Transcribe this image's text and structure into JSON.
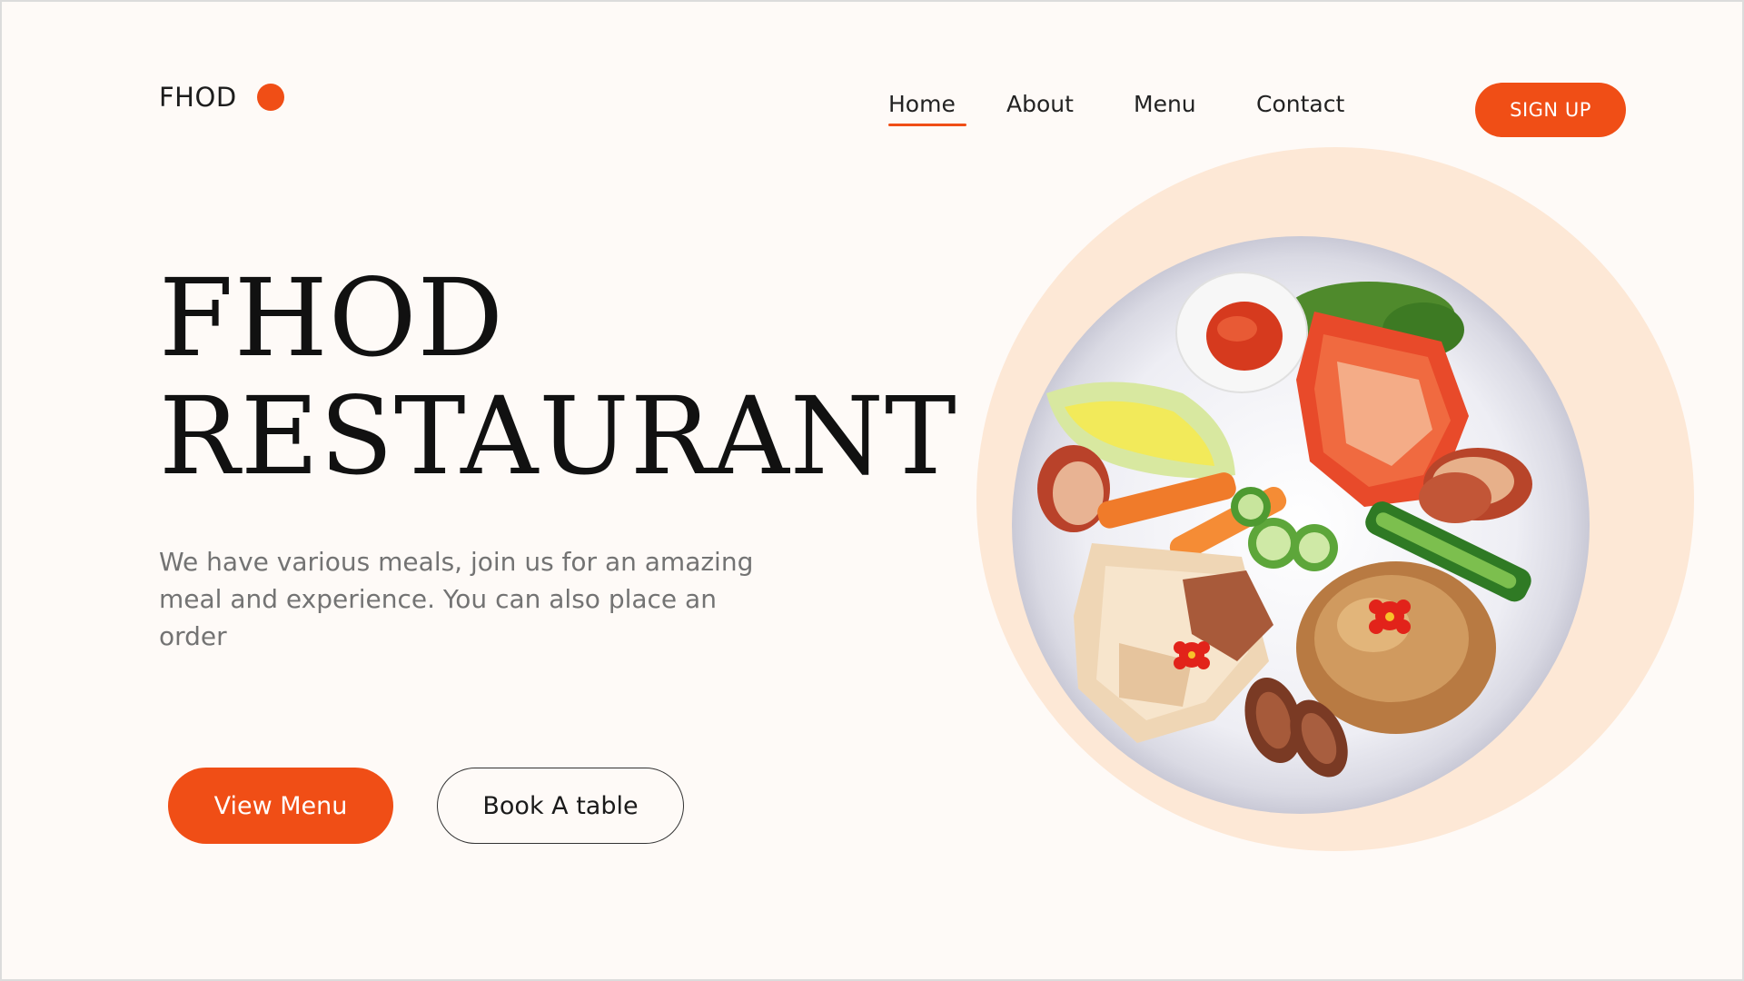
{
  "brand": {
    "name": "FHOD",
    "accent_color": "#f04e16"
  },
  "nav": {
    "items": [
      {
        "label": "Home",
        "active": true
      },
      {
        "label": "About",
        "active": false
      },
      {
        "label": "Menu",
        "active": false
      },
      {
        "label": "Contact",
        "active": false
      }
    ],
    "signup_label": "SIGN UP"
  },
  "hero": {
    "title_line1": "FHOD",
    "title_line2": "RESTAURANT",
    "description": "We have various meals, join us for an amazing meal and experience. You can also place an order",
    "primary_button": "View Menu",
    "secondary_button": "Book A table",
    "image": {
      "icon": "food-plate-icon",
      "background_color": "#fde8d6"
    }
  }
}
